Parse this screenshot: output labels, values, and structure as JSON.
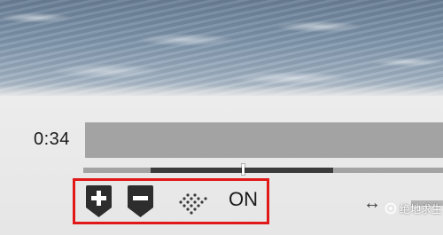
{
  "playback": {
    "time": "0:34",
    "progress": 0.44
  },
  "controls": {
    "zoom_in_icon": "plus-pin-icon",
    "zoom_out_icon": "minus-pin-icon",
    "pattern_icon": "dotted-pattern-icon",
    "toggle_state": "ON"
  },
  "misc": {
    "arrow_icon": "horizontal-double-arrow-icon",
    "arrow_glyph": "↔",
    "watermark_text": "绝地求生"
  },
  "colors": {
    "highlight": "#e01818",
    "track": "#a3a3a3",
    "track_fill": "#3b3b3b",
    "button": "#2d2d2d"
  }
}
